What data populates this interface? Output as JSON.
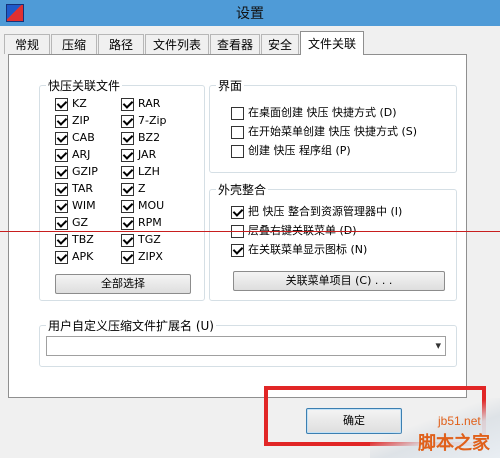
{
  "window": {
    "title": "设置"
  },
  "tabs": [
    {
      "label": "常规"
    },
    {
      "label": "压缩"
    },
    {
      "label": "路径"
    },
    {
      "label": "文件列表"
    },
    {
      "label": "查看器"
    },
    {
      "label": "安全"
    },
    {
      "label": "文件关联",
      "active": true
    }
  ],
  "assoc": {
    "legend": "快压关联文件",
    "items": [
      {
        "label": "KZ",
        "checked": true
      },
      {
        "label": "RAR",
        "checked": true
      },
      {
        "label": "ZIP",
        "checked": true
      },
      {
        "label": "7-Zip",
        "checked": true
      },
      {
        "label": "CAB",
        "checked": true
      },
      {
        "label": "BZ2",
        "checked": true
      },
      {
        "label": "ARJ",
        "checked": true
      },
      {
        "label": "JAR",
        "checked": true
      },
      {
        "label": "GZIP",
        "checked": true
      },
      {
        "label": "LZH",
        "checked": true
      },
      {
        "label": "TAR",
        "checked": true
      },
      {
        "label": "Z",
        "checked": true
      },
      {
        "label": "WIM",
        "checked": true
      },
      {
        "label": "MOU",
        "checked": true
      },
      {
        "label": "GZ",
        "checked": true
      },
      {
        "label": "RPM",
        "checked": true
      },
      {
        "label": "TBZ",
        "checked": true
      },
      {
        "label": "TGZ",
        "checked": true
      },
      {
        "label": "APK",
        "checked": true
      },
      {
        "label": "ZIPX",
        "checked": true
      }
    ],
    "select_all_label": "全部选择"
  },
  "interface": {
    "legend": "界面",
    "items": [
      {
        "label": "在桌面创建 快压 快捷方式 (D)",
        "checked": false
      },
      {
        "label": "在开始菜单创建 快压 快捷方式 (S)",
        "checked": false
      },
      {
        "label": "创建 快压 程序组 (P)",
        "checked": false
      }
    ]
  },
  "shell": {
    "legend": "外壳整合",
    "items": [
      {
        "label": "把 快压 整合到资源管理器中 (I)",
        "checked": true
      },
      {
        "label": "层叠右键关联菜单 (D)",
        "checked": false
      },
      {
        "label": "在关联菜单显示图标 (N)",
        "checked": true
      }
    ],
    "menu_items_label": "关联菜单项目 (C) . . ."
  },
  "custom_ext": {
    "legend": "用户自定义压缩文件扩展名 (U)",
    "value": ""
  },
  "footer": {
    "ok_label": "确定"
  },
  "watermark": {
    "site": "jb51.net",
    "name": "脚本之家"
  }
}
